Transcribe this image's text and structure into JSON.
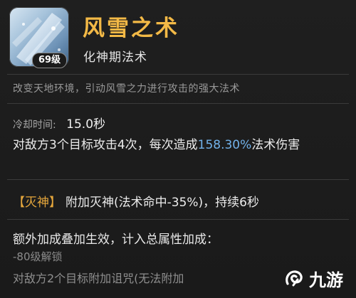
{
  "skill": {
    "name": "风雪之术",
    "type": "化神期法术",
    "level_badge": "69级",
    "icon": "snowstorm-skill-icon"
  },
  "description": "改变天地环境，引动风雪之力进行攻击的强大法术",
  "cooldown": {
    "label": "冷却时间:",
    "value": "15.0秒"
  },
  "effect": {
    "text_before": "对敌方3个目标攻击4次，每次造成",
    "highlight": "158.30%",
    "text_after": "法术伤害"
  },
  "status": {
    "tag": "【灭神】",
    "text": "附加灭神(法术命中-35%)，持续6秒"
  },
  "bonus": {
    "title": "额外加成叠加生效，计入总属性加成：",
    "unlock": "-80级解锁",
    "extra": "对敌方2个目标附加诅咒(无法附加"
  },
  "watermark": {
    "text": "九游",
    "icon": "jiuyou-logo-icon"
  },
  "colors": {
    "name": "#f3b946",
    "highlight": "#72b2ea",
    "tag": "#e6a73c"
  }
}
